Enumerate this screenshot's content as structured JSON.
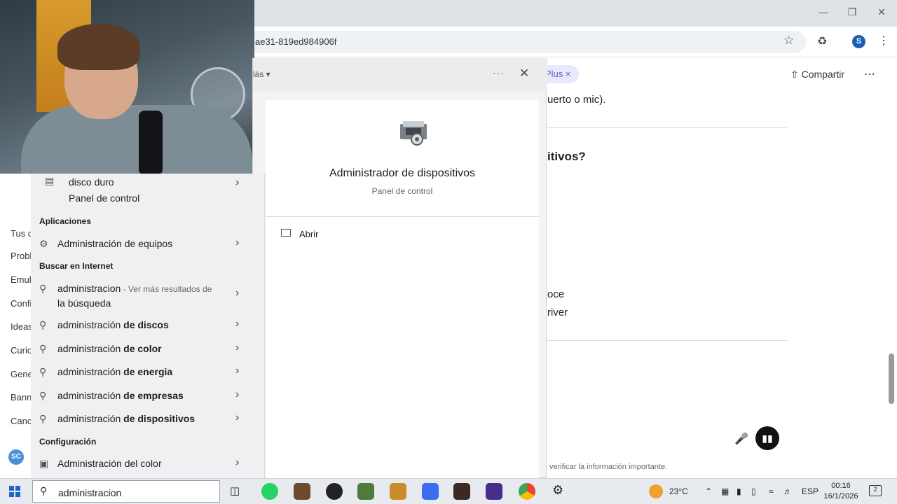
{
  "browser": {
    "url_fragment": "ae31-819ed984906f",
    "profile_initial": "S",
    "chip_label": "Plus",
    "share_label": "Compartir",
    "chat_lines": [
      "uerto o mic).",
      "itivos?",
      "oce",
      "river"
    ],
    "disclaimer": "verificar la información importante."
  },
  "sidebar": {
    "items": [
      "Probl",
      "Emul",
      "Confi",
      "Ideas",
      "Curio",
      "Gene",
      "Bann",
      "Canc"
    ],
    "section_label": "Tus c",
    "avatar": "SC"
  },
  "search": {
    "top_result": {
      "title": "disco duro",
      "subtitle": "Panel de control"
    },
    "section_apps": "Aplicaciones",
    "apps": [
      {
        "label": "Administración de equipos"
      }
    ],
    "section_web": "Buscar en Internet",
    "web_first": {
      "query": "administracion",
      "hint": " - Ver más resultados de",
      "hint2": "la búsqueda"
    },
    "web_suggestions": [
      {
        "prefix": "administración ",
        "bold": "de discos"
      },
      {
        "prefix": "administración ",
        "bold": "de color"
      },
      {
        "prefix": "administración ",
        "bold": "de energia"
      },
      {
        "prefix": "administración ",
        "bold": "de empresas"
      },
      {
        "prefix": "administración ",
        "bold": "de dispositivos"
      }
    ],
    "section_config": "Configuración",
    "config": [
      {
        "label": "Administración del color"
      }
    ],
    "query": "administracion"
  },
  "detail": {
    "more_label": "lás",
    "title": "Administrador de dispositivos",
    "subtitle": "Panel de control",
    "action_open": "Abrir"
  },
  "taskbar": {
    "weather": "23°C",
    "language": "ESP",
    "time": "00:16",
    "date": "16/1/2026",
    "notification_count": "2"
  }
}
